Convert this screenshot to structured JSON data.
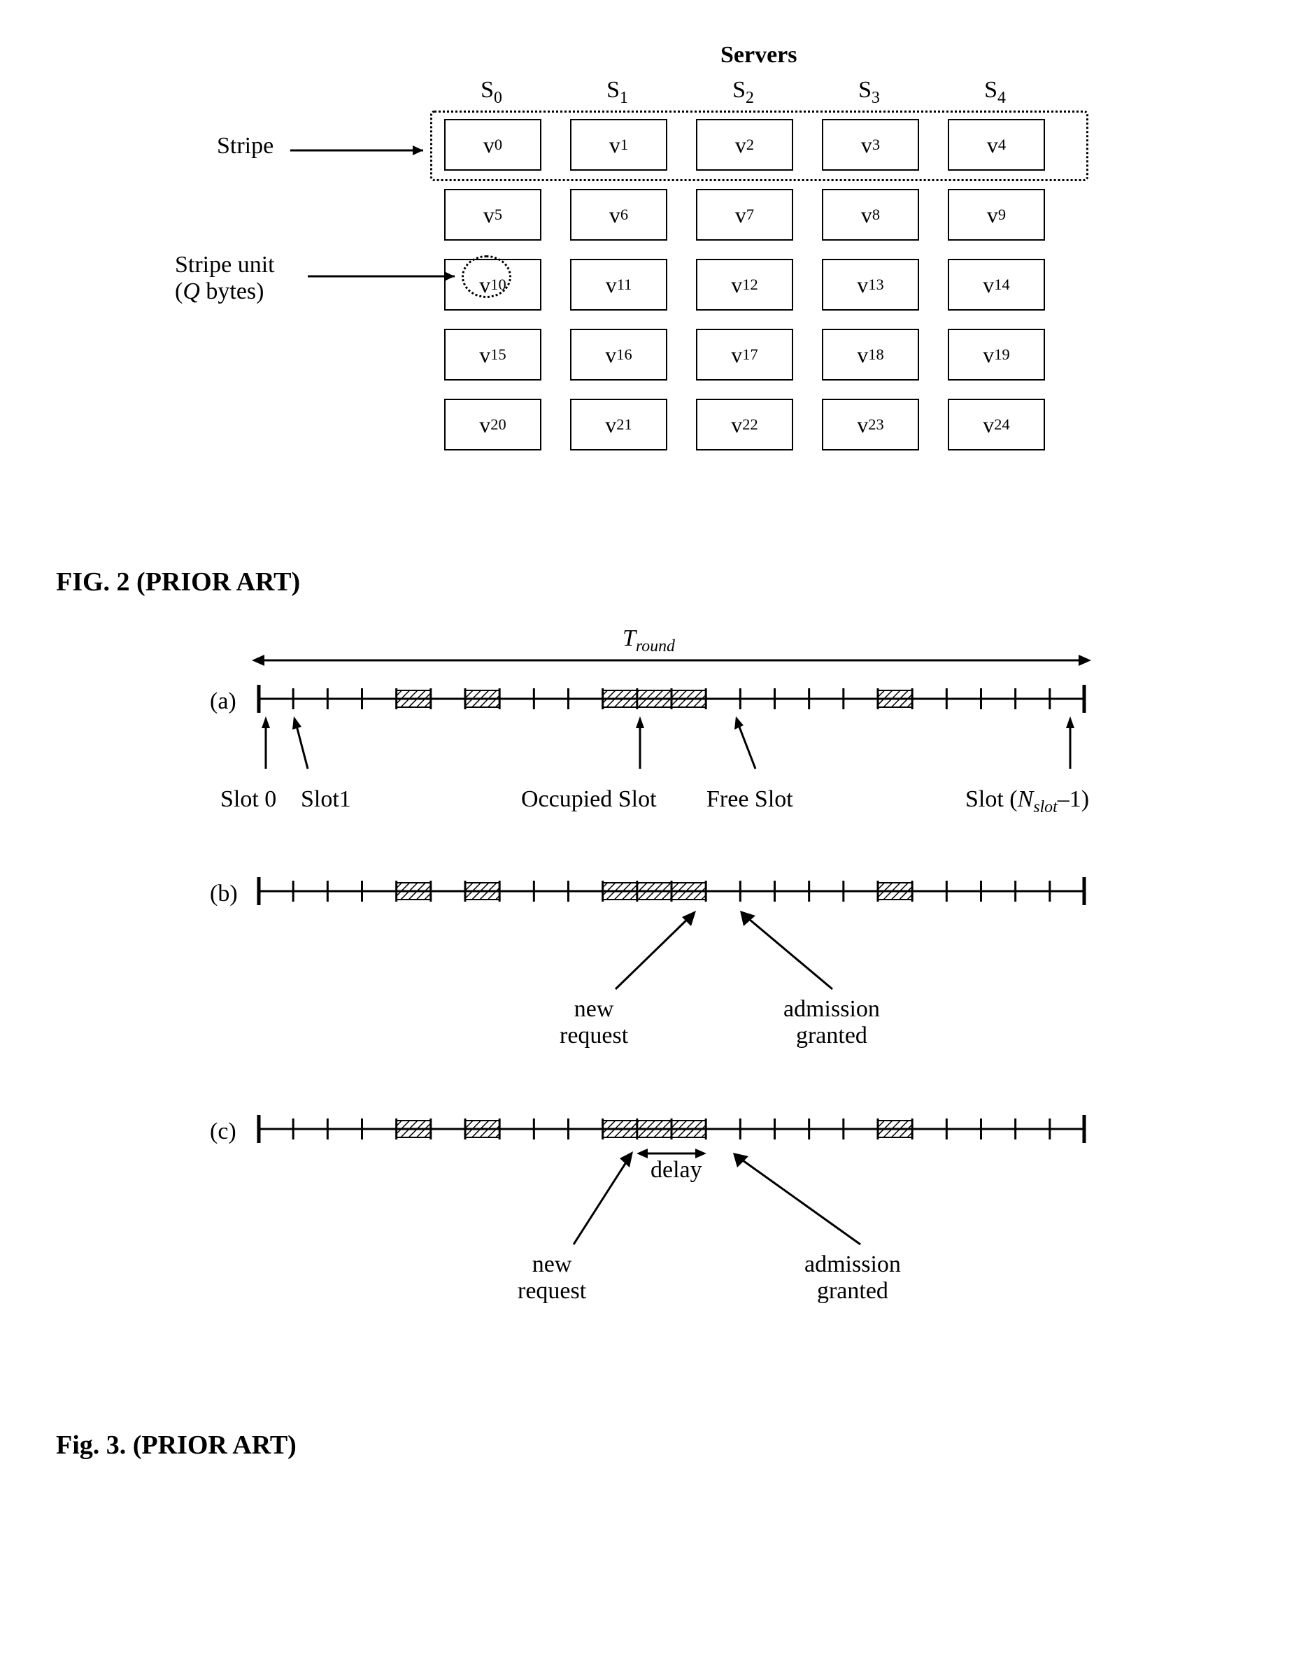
{
  "fig2": {
    "servers_title": "Servers",
    "cols": [
      "S0",
      "S1",
      "S2",
      "S3",
      "S4"
    ],
    "rows": [
      [
        "v0",
        "v1",
        "v2",
        "v3",
        "v4"
      ],
      [
        "v5",
        "v6",
        "v7",
        "v8",
        "v9"
      ],
      [
        "v10",
        "v11",
        "v12",
        "v13",
        "v14"
      ],
      [
        "v15",
        "v16",
        "v17",
        "v18",
        "v19"
      ],
      [
        "v20",
        "v21",
        "v22",
        "v23",
        "v24"
      ]
    ],
    "stripe_label": "Stripe",
    "stripe_unit_label": "Stripe unit",
    "stripe_unit_sub": "(Q bytes)",
    "stripe_unit_q_italic": "Q"
  },
  "fig2_caption": "FIG. 2 (PRIOR ART)",
  "fig3": {
    "tround": "Tround",
    "labels": {
      "a": "(a)",
      "b": "(b)",
      "c": "(c)",
      "slot0": "Slot 0",
      "slot1": "Slot1",
      "occupied": "Occupied Slot",
      "free": "Free Slot",
      "last": "Slot (Nslot–1)",
      "newreq": "new\nrequest",
      "admgrant": "admission\ngranted",
      "delay": "delay"
    },
    "num_slots": 24,
    "occupied_a": [
      4,
      6,
      10,
      11,
      12,
      18
    ],
    "occupied_b": [
      4,
      6,
      10,
      11,
      12,
      18
    ],
    "occupied_c": [
      4,
      6,
      10,
      11,
      12,
      18
    ]
  },
  "fig3_caption": "Fig. 3. (PRIOR ART)",
  "chart_data": {
    "type": "table",
    "title": "Servers stripe layout",
    "columns": [
      "S0",
      "S1",
      "S2",
      "S3",
      "S4"
    ],
    "rows": [
      [
        "v0",
        "v1",
        "v2",
        "v3",
        "v4"
      ],
      [
        "v5",
        "v6",
        "v7",
        "v8",
        "v9"
      ],
      [
        "v10",
        "v11",
        "v12",
        "v13",
        "v14"
      ],
      [
        "v15",
        "v16",
        "v17",
        "v18",
        "v19"
      ],
      [
        "v20",
        "v21",
        "v22",
        "v23",
        "v24"
      ]
    ],
    "annotations": {
      "stripe_row": 0,
      "stripe_unit_cell": "v10"
    }
  }
}
